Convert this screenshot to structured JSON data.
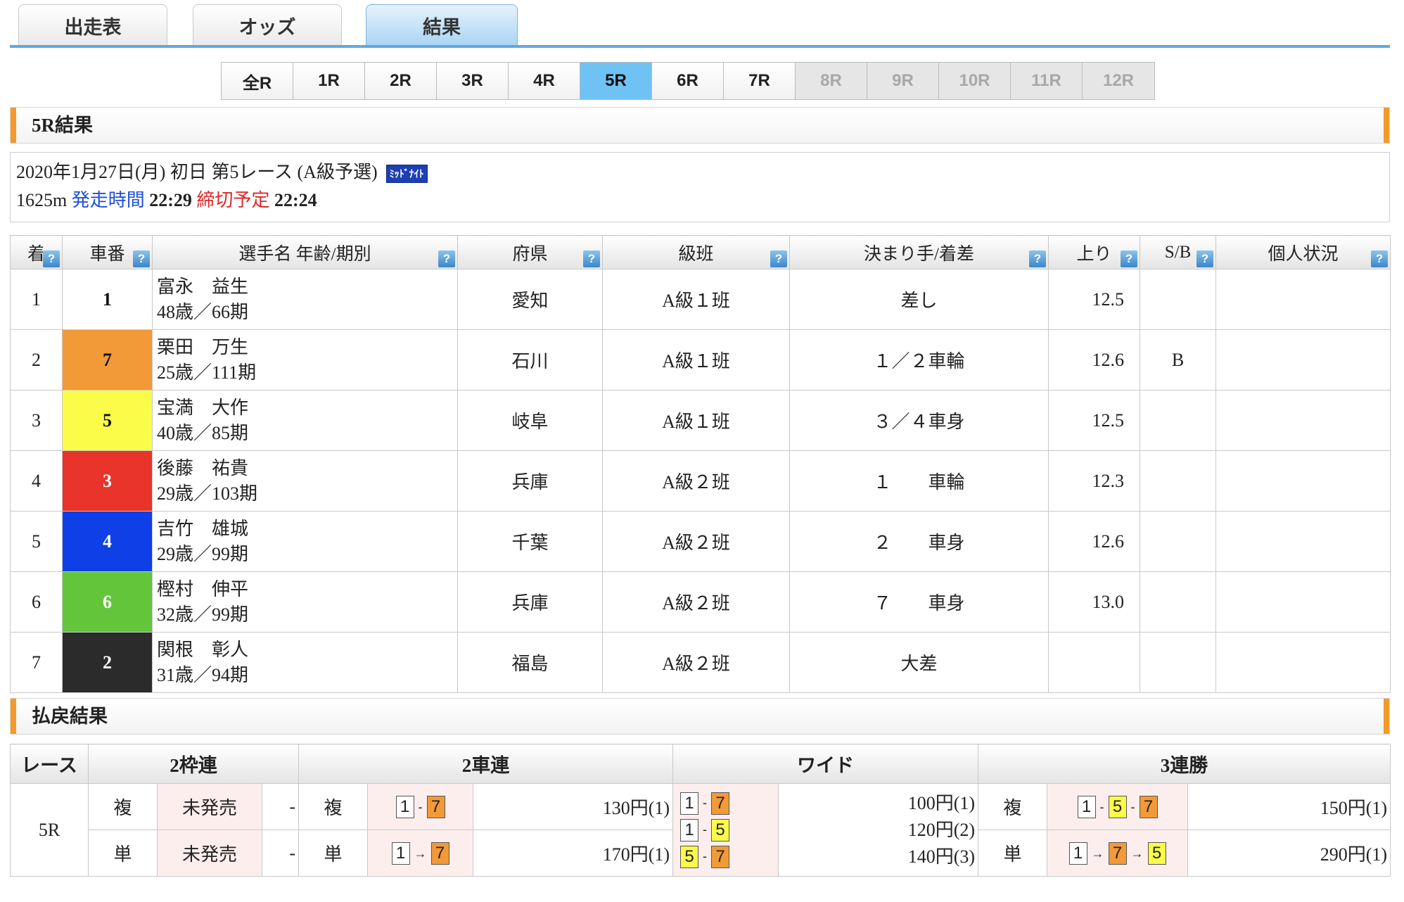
{
  "tabs": [
    {
      "label": "出走表",
      "active": false
    },
    {
      "label": "オッズ",
      "active": false
    },
    {
      "label": "結果",
      "active": true
    }
  ],
  "races": [
    {
      "label": "全R",
      "state": "normal"
    },
    {
      "label": "1R",
      "state": "normal"
    },
    {
      "label": "2R",
      "state": "normal"
    },
    {
      "label": "3R",
      "state": "normal"
    },
    {
      "label": "4R",
      "state": "normal"
    },
    {
      "label": "5R",
      "state": "active"
    },
    {
      "label": "6R",
      "state": "normal"
    },
    {
      "label": "7R",
      "state": "normal"
    },
    {
      "label": "8R",
      "state": "disabled"
    },
    {
      "label": "9R",
      "state": "disabled"
    },
    {
      "label": "10R",
      "state": "disabled"
    },
    {
      "label": "11R",
      "state": "disabled"
    },
    {
      "label": "12R",
      "state": "disabled"
    }
  ],
  "result_section": {
    "title": "5R結果"
  },
  "race_info": {
    "date_line": "2020年1月27日(月) 初日 第5レース (A級予選)",
    "badge": "ﾐｯﾄﾞﾅｲﾄ",
    "distance": "1625m",
    "start_label": "発走時間",
    "start_time": "22:29",
    "close_label": "締切予定",
    "close_time": "22:24"
  },
  "results_table": {
    "headers": [
      "着",
      "車番",
      "選手名 年齢/期別",
      "府県",
      "級班",
      "決まり手/着差",
      "上り",
      "S/B",
      "個人状況"
    ],
    "help_icon": "?",
    "rows": [
      {
        "rank": "1",
        "car": "1",
        "name": "富永　益生",
        "age": "48歳／66期",
        "pref": "愛知",
        "class": "A級１班",
        "decision": "差し",
        "agari": "12.5",
        "sb": "",
        "status": ""
      },
      {
        "rank": "2",
        "car": "7",
        "name": "栗田　万生",
        "age": "25歳／111期",
        "pref": "石川",
        "class": "A級１班",
        "decision": "１／２車輪",
        "agari": "12.6",
        "sb": "B",
        "status": ""
      },
      {
        "rank": "3",
        "car": "5",
        "name": "宝満　大作",
        "age": "40歳／85期",
        "pref": "岐阜",
        "class": "A級１班",
        "decision": "３／４車身",
        "agari": "12.5",
        "sb": "",
        "status": ""
      },
      {
        "rank": "4",
        "car": "3",
        "name": "後藤　祐貴",
        "age": "29歳／103期",
        "pref": "兵庫",
        "class": "A級２班",
        "decision": "１　　車輪",
        "agari": "12.3",
        "sb": "",
        "status": ""
      },
      {
        "rank": "5",
        "car": "4",
        "name": "吉竹　雄城",
        "age": "29歳／99期",
        "pref": "千葉",
        "class": "A級２班",
        "decision": "２　　車身",
        "agari": "12.6",
        "sb": "",
        "status": ""
      },
      {
        "rank": "6",
        "car": "6",
        "name": "樫村　伸平",
        "age": "32歳／99期",
        "pref": "兵庫",
        "class": "A級２班",
        "decision": "７　　車身",
        "agari": "13.0",
        "sb": "",
        "status": ""
      },
      {
        "rank": "7",
        "car": "2",
        "name": "関根　彰人",
        "age": "31歳／94期",
        "pref": "福島",
        "class": "A級２班",
        "decision": "大差",
        "agari": "",
        "sb": "",
        "status": ""
      }
    ]
  },
  "car_colors": {
    "1": {
      "bg": "#ffffff",
      "fg": "#111111"
    },
    "2": {
      "bg": "#2b2b2b",
      "fg": "#ffffff"
    },
    "3": {
      "bg": "#e8342a",
      "fg": "#ffffff"
    },
    "4": {
      "bg": "#0f3fe6",
      "fg": "#ffffff"
    },
    "5": {
      "bg": "#fbfb4a",
      "fg": "#111111"
    },
    "6": {
      "bg": "#63c53a",
      "fg": "#ffffff"
    },
    "7": {
      "bg": "#f29a38",
      "fg": "#111111"
    }
  },
  "payout_section": {
    "title": "払戻結果"
  },
  "payout": {
    "headers": {
      "race": "レース",
      "waku": "2枠連",
      "shaken": "2車連",
      "wide": "ワイド",
      "sanren": "3連勝"
    },
    "race": "5R",
    "fuku": "複",
    "tan": "単",
    "waku_fuku": "未発売",
    "waku_tan": "未発売",
    "dash": "-",
    "shaken_fuku": {
      "combo": [
        "1",
        "7"
      ],
      "amount": "130円(1)"
    },
    "shaken_tan": {
      "combo": [
        "1",
        "7"
      ],
      "amount": "170円(1)"
    },
    "wide": [
      {
        "combo": [
          "1",
          "7"
        ],
        "amount": "100円(1)"
      },
      {
        "combo": [
          "1",
          "5"
        ],
        "amount": "120円(2)"
      },
      {
        "combo": [
          "5",
          "7"
        ],
        "amount": "140円(3)"
      }
    ],
    "sanren_fuku": {
      "combo": [
        "1",
        "5",
        "7"
      ],
      "amount": "150円(1)"
    },
    "sanren_tan": {
      "combo": [
        "1",
        "7",
        "5"
      ],
      "amount": "290円(1)"
    },
    "sep_box": "-",
    "sep_exacta": "→"
  },
  "box_colors": {
    "1": "#ffffff",
    "5": "#fbfb4a",
    "7": "#f29a38"
  }
}
